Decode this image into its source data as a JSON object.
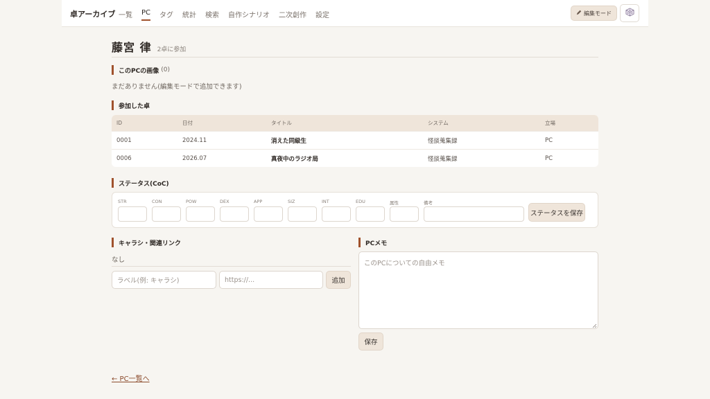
{
  "header": {
    "brand": "卓アーカイブ",
    "nav": [
      "一覧",
      "PC",
      "タグ",
      "統計",
      "検索",
      "自作シナリオ",
      "二次創作",
      "設定"
    ],
    "active_nav": "PC",
    "edit_mode_label": "編集モード",
    "dice_icon": "dice-icon"
  },
  "pc": {
    "name": "藤宮 律",
    "participation": "2卓に参加"
  },
  "images_section": {
    "title": "このPCの画像",
    "count": "(0)",
    "empty_text": "まだありません(編集モードで追加できます)"
  },
  "sessions_section": {
    "title": "参加した卓",
    "columns": [
      "ID",
      "日付",
      "タイトル",
      "システム",
      "立場"
    ],
    "rows": [
      {
        "id": "0001",
        "date": "2024.11",
        "title": "消えた同級生",
        "system": "怪談蒐集録",
        "role": "PC"
      },
      {
        "id": "0006",
        "date": "2026.07",
        "title": "真夜中のラジオ局",
        "system": "怪談蒐集録",
        "role": "PC"
      }
    ]
  },
  "status_section": {
    "title": "ステータス(CoC)",
    "stats": [
      "STR",
      "CON",
      "POW",
      "DEX",
      "APP",
      "SIZ",
      "INT",
      "EDU",
      "属性"
    ],
    "notes_label": "備考",
    "save_label": "ステータスを保存"
  },
  "links_section": {
    "title": "キャラシ・関連リンク",
    "empty_text": "なし",
    "label_placeholder": "ラベル(例: キャラシ)",
    "url_placeholder": "https://...",
    "add_label": "追加"
  },
  "memo_section": {
    "title": "PCメモ",
    "placeholder": "このPCについての自由メモ",
    "save_label": "保存"
  },
  "back_link": "← PC一覧へ",
  "colors": {
    "accent": "#a0522d",
    "button_bg": "#efe5da",
    "page_bg": "#f7f5f1"
  }
}
